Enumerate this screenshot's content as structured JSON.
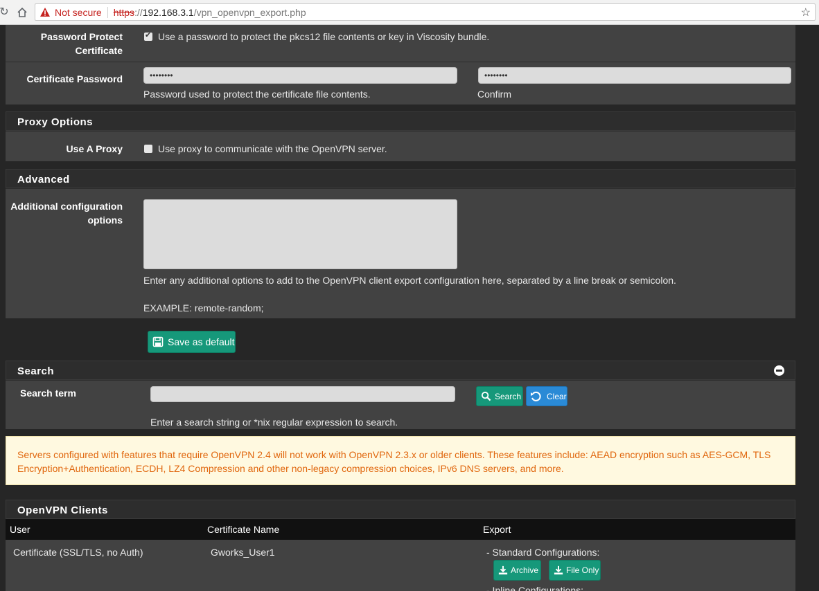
{
  "browser": {
    "security_label": "Not secure",
    "url_protocol": "https",
    "url_sep": "://",
    "url_host": "192.168.3.1",
    "url_path": "/vpn_openvpn_export.php"
  },
  "cert": {
    "protect_label": "Password Protect Certificate",
    "protect_text": "Use a password to protect the pkcs12 file contents or key in Viscosity bundle.",
    "protect_checked": true,
    "password_label": "Certificate Password",
    "password_value": "••••••••",
    "password_help": "Password used to protect the certificate file contents.",
    "confirm_value": "••••••••",
    "confirm_help": "Confirm"
  },
  "proxy": {
    "title": "Proxy Options",
    "label": "Use A Proxy",
    "text": "Use proxy to communicate with the OpenVPN server.",
    "checked": false
  },
  "advanced": {
    "title": "Advanced",
    "label": "Additional configuration options",
    "help": "Enter any additional options to add to the OpenVPN client export configuration here, separated by a line break or semicolon.",
    "example": "EXAMPLE: remote-random;"
  },
  "save_button": "Save as default",
  "search": {
    "title": "Search",
    "label": "Search term",
    "help": "Enter a search string or *nix regular expression to search.",
    "search_button": "Search",
    "clear_button": "Clear"
  },
  "notice": "Servers configured with features that require OpenVPN 2.4 will not work with OpenVPN 2.3.x or older clients. These features include: AEAD encryption such as AES-GCM, TLS Encryption+Authentication, ECDH, LZ4 Compression and other non-legacy compression choices, IPv6 DNS servers, and more.",
  "clients": {
    "title": "OpenVPN Clients",
    "columns": [
      "User",
      "Certificate Name",
      "Export"
    ],
    "row": {
      "user": "Certificate (SSL/TLS, no Auth)",
      "cert": "Gworks_User1",
      "standard": "- Standard Configurations:",
      "archive": "Archive",
      "file_only": "File Only",
      "inline": "- Inline Configurations:"
    }
  },
  "colors": {
    "accent_teal": "#16987a",
    "accent_blue": "#2a8ad6",
    "warning_text": "#e0660d"
  }
}
